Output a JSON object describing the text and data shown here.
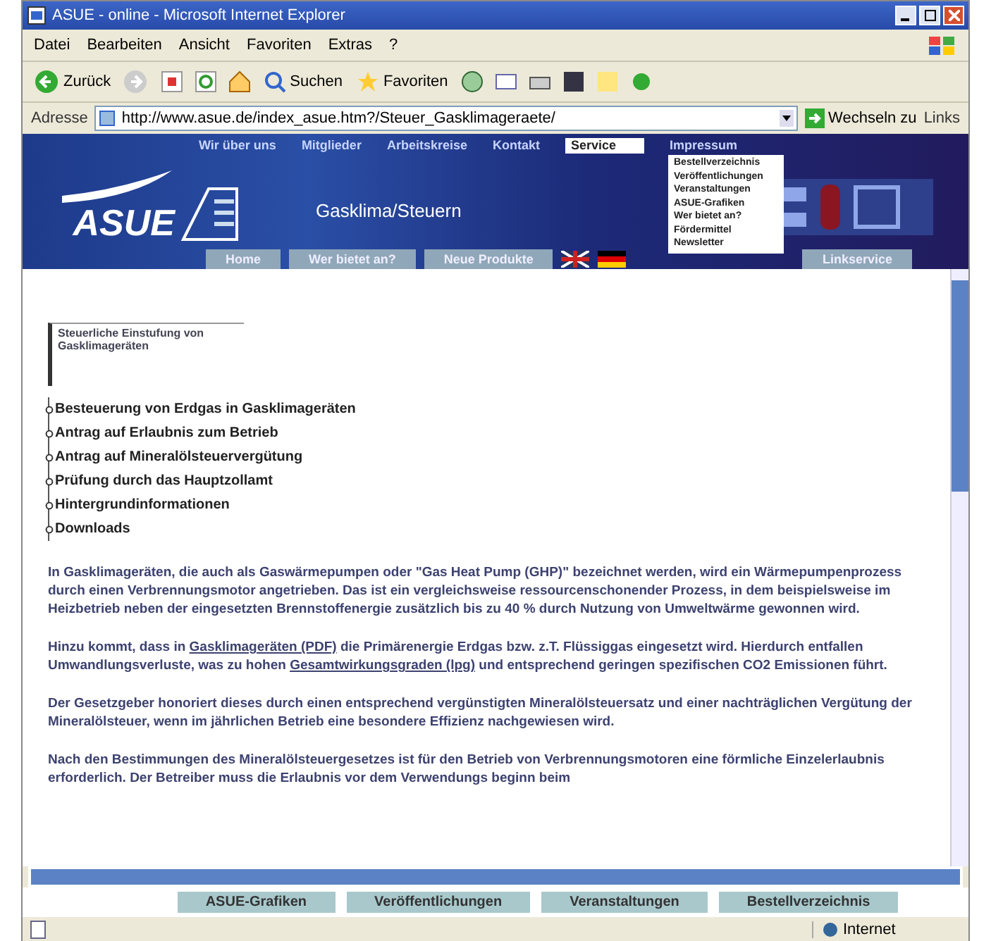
{
  "window": {
    "title": "ASUE - online - Microsoft Internet Explorer"
  },
  "menu_bar": [
    "Datei",
    "Bearbeiten",
    "Ansicht",
    "Favoriten",
    "Extras",
    "?"
  ],
  "toolbar": {
    "back": "Zurück",
    "search": "Suchen",
    "favorites": "Favoriten"
  },
  "address_bar": {
    "label": "Adresse",
    "value": "http://www.asue.de/index_asue.htm?/Steuer_Gasklimageraete/",
    "go": "Wechseln zu",
    "links": "Links"
  },
  "site_nav": [
    {
      "label": "Wir über uns",
      "selected": false
    },
    {
      "label": "Mitglieder",
      "selected": false
    },
    {
      "label": "Arbeitskreise",
      "selected": false
    },
    {
      "label": "Kontakt",
      "selected": false
    },
    {
      "label": "Service",
      "selected": true
    },
    {
      "label": "Impressum",
      "selected": false
    }
  ],
  "service_menu": [
    "Bestellverzeichnis",
    "Veröffentlichungen",
    "Veranstaltungen",
    "ASUE-Grafiken",
    "Wer bietet an?",
    "Fördermittel",
    "Newsletter"
  ],
  "banner": {
    "logo": "ASUE",
    "subtitle": "Gasklima/Steuern"
  },
  "sub_nav": [
    "Home",
    "Wer bietet an?",
    "Neue Produkte"
  ],
  "link_service": "Linkservice",
  "heading": "Steuerliche Einstufung von Gasklimageräten",
  "toc": [
    "Besteuerung von Erdgas in Gasklimageräten",
    "Antrag auf Erlaubnis zum Betrieb",
    "Antrag auf Mineralölsteuervergütung",
    "Prüfung durch das Hauptzollamt",
    "Hintergrundinformationen",
    "Downloads"
  ],
  "paragraphs": [
    {
      "parts": [
        {
          "text": "In Gasklimageräten, die auch als Gaswärmepumpen oder \"Gas Heat Pump (GHP)\" bezeichnet werden, wird ein Wärmepumpenprozess durch einen Verbrennungsmotor angetrieben. Das ist ein vergleichsweise ressourcenschonender Prozess, in dem beispielsweise im Heizbetrieb neben der eingesetzten Brennstoffenergie zusätzlich bis zu 40 % durch Nutzung von Umweltwärme gewonnen wird.",
          "link": false
        }
      ]
    },
    {
      "parts": [
        {
          "text": "Hinzu kommt, dass in",
          "link": false
        },
        {
          "text": "Gasklimageräten (PDF)",
          "link": true
        },
        {
          "text": "die Primärenergie Erdgas bzw. z.T. Flüssiggas eingesetzt wird. Hierdurch entfallen Umwandlungsverluste, was zu hohen",
          "link": false
        },
        {
          "text": "Gesamtwirkungsgraden (lpg)",
          "link": true
        },
        {
          "text": "und entsprechend geringen spezifischen CO2 Emissionen führt.",
          "link": false
        }
      ]
    },
    {
      "parts": [
        {
          "text": "Der Gesetzgeber honoriert dieses durch einen entsprechend vergünstigten Mineralölsteuersatz und einer nachträglichen Vergütung der Mineralölsteuer, wenn im jährlichen Betrieb eine besondere Effizienz nachgewiesen wird.",
          "link": false
        }
      ]
    },
    {
      "parts": [
        {
          "text": "Nach den Bestimmungen des Mineralölsteuergesetzes ist für den Betrieb von Verbrennungsmotoren eine förmliche Einzelerlaubnis erforderlich. Der Betreiber muss die Erlaubnis vor dem Verwendungs beginn beim",
          "link": false
        }
      ]
    }
  ],
  "bottom_nav": [
    "ASUE-Grafiken",
    "Veröffentlichungen",
    "Veranstaltungen",
    "Bestellverzeichnis"
  ],
  "status_bar": {
    "zone": "Internet"
  }
}
